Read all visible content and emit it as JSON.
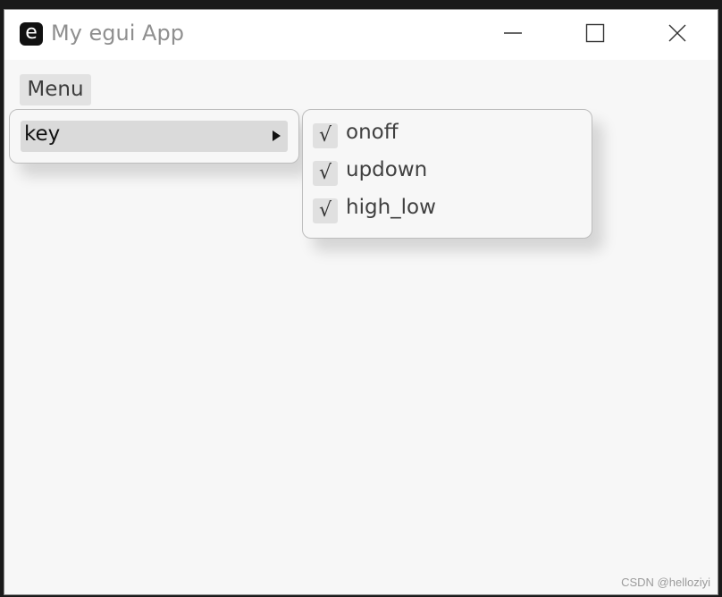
{
  "window": {
    "title": "My egui App",
    "icon_letter": "e"
  },
  "menubar": {
    "menu_label": "Menu"
  },
  "menu": {
    "item_label": "key"
  },
  "submenu": {
    "items": [
      {
        "label": "onoff",
        "checked": true,
        "check_glyph": "√"
      },
      {
        "label": "updown",
        "checked": true,
        "check_glyph": "√"
      },
      {
        "label": "high_low",
        "checked": true,
        "check_glyph": "√"
      }
    ]
  },
  "watermark": "CSDN @helloziyi",
  "colors": {
    "window_bg": "#f7f7f7",
    "titlebar_bg": "#ffffff",
    "hover_bg": "#dadada"
  }
}
